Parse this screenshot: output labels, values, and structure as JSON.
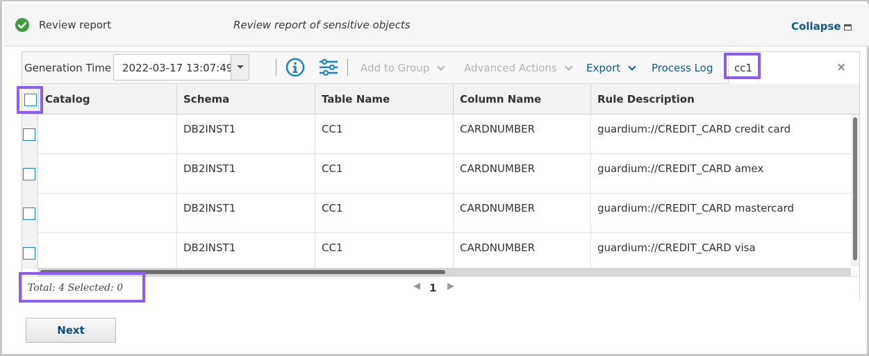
{
  "header": {
    "status_icon": "check-circle-icon",
    "title": "Review report",
    "description": "Review report of sensitive objects",
    "collapse_label": "Collapse",
    "collapse_icon": "minimize-icon"
  },
  "toolbar": {
    "generation_label": "Generation Time",
    "generation_value": "2022-03-17 13:07:49",
    "info_icon": "info-icon",
    "settings_icon": "sliders-icon",
    "add_to_group": "Add to Group",
    "advanced_actions": "Advanced Actions",
    "export": "Export",
    "process_log": "Process Log",
    "search_value": "cc1",
    "clear_icon": "×"
  },
  "table": {
    "columns": [
      "Catalog",
      "Schema",
      "Table Name",
      "Column Name",
      "Rule Description"
    ],
    "rows": [
      {
        "catalog": "",
        "schema": "DB2INST1",
        "table": "CC1",
        "column": "CARDNUMBER",
        "rule": "guardium://CREDIT_CARD credit card"
      },
      {
        "catalog": "",
        "schema": "DB2INST1",
        "table": "CC1",
        "column": "CARDNUMBER",
        "rule": "guardium://CREDIT_CARD amex"
      },
      {
        "catalog": "",
        "schema": "DB2INST1",
        "table": "CC1",
        "column": "CARDNUMBER",
        "rule": "guardium://CREDIT_CARD mastercard"
      },
      {
        "catalog": "",
        "schema": "DB2INST1",
        "table": "CC1",
        "column": "CARDNUMBER",
        "rule": "guardium://CREDIT_CARD visa"
      }
    ]
  },
  "footer": {
    "totals": "Total: 4 Selected: 0",
    "page": "1"
  },
  "actions": {
    "next_label": "Next"
  },
  "colors": {
    "link": "#0f5b8c",
    "highlight": "#8b5cf6",
    "checkbox": "#1a83c6",
    "success": "#3a9d3a"
  }
}
